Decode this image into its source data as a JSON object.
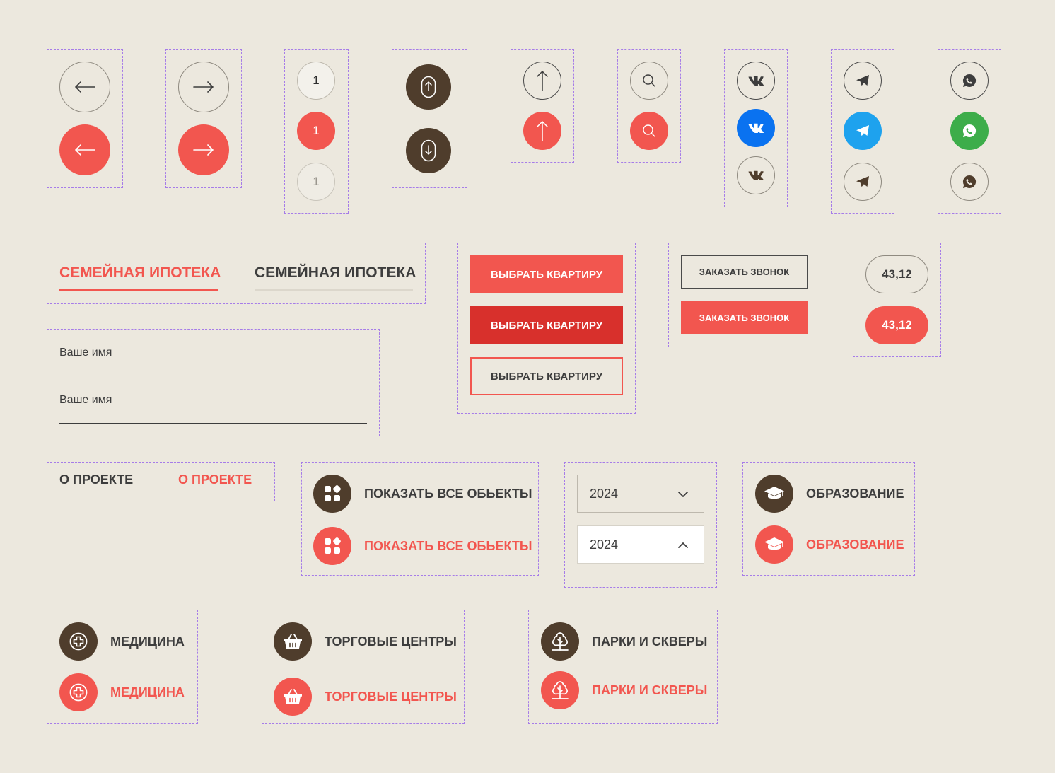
{
  "colors": {
    "background": "#ece8de",
    "accent": "#f2564f",
    "accent_dark": "#d8302c",
    "brown": "#4f3d2c",
    "vk_blue": "#0a72f0",
    "telegram_blue": "#1ea2ee",
    "whatsapp_green": "#3dad4a",
    "dash_border": "#a67ce8"
  },
  "pagination": {
    "default": "1",
    "active": "1",
    "disabled": "1"
  },
  "tabs": {
    "active": "СЕМЕЙНАЯ ИПОТЕКА",
    "inactive": "СЕМЕЙНАЯ ИПОТЕКА"
  },
  "form": {
    "name_placeholder": "Ваше имя",
    "name_filled": "Ваше имя"
  },
  "buttons": {
    "choose_flat_default": "ВЫБРАТЬ КВАРТИРУ",
    "choose_flat_hover": "ВЫБРАТЬ КВАРТИРУ",
    "choose_flat_outline": "ВЫБРАТЬ КВАРТИРУ",
    "callback_outline": "ЗАКАЗАТЬ ЗВОНОК",
    "callback_filled": "ЗАКАЗАТЬ ЗВОНОК"
  },
  "area_pills": {
    "outline": "43,12",
    "filled": "43,12"
  },
  "nav_links": {
    "about_default": "О ПРОЕКТЕ",
    "about_active": "О ПРОЕКТЕ"
  },
  "show_all": {
    "default": "ПОКАЗАТЬ ВСЕ ОБЬЕКТЫ",
    "active": "ПОКАЗАТЬ ВСЕ ОБЬЕКТЫ"
  },
  "year_select": {
    "closed_value": "2024",
    "open_value": "2024"
  },
  "categories": {
    "education": "ОБРАЗОВАНИЕ",
    "medicine": "МЕДИЦИНА",
    "malls": "ТОРГОВЫЕ ЦЕНТРЫ",
    "parks": "ПАРКИ И СКВЕРЫ"
  },
  "icons": {
    "arrow_left": "arrow-left-icon",
    "arrow_right": "arrow-right-icon",
    "scroll_up": "mouse-scroll-up-icon",
    "scroll_down": "mouse-scroll-down-icon",
    "to_top": "arrow-up-icon",
    "search": "search-icon",
    "vk": "vk-icon",
    "telegram": "telegram-icon",
    "whatsapp": "whatsapp-icon",
    "grid": "grid-icon",
    "graduation": "graduation-cap-icon",
    "medical": "medical-cross-icon",
    "basket": "shopping-basket-icon",
    "tree": "tree-icon",
    "chevron_down": "chevron-down-icon",
    "chevron_up": "chevron-up-icon"
  }
}
